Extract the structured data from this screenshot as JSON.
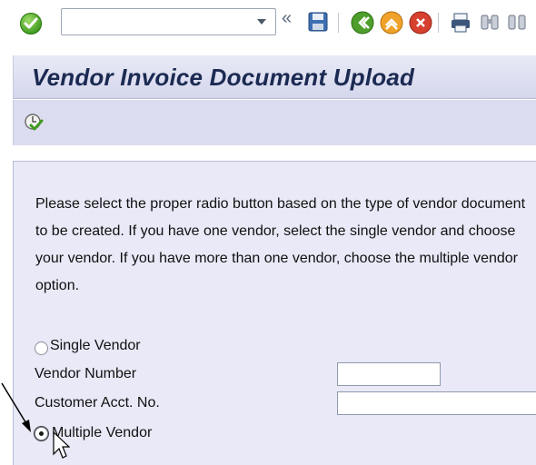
{
  "toolbar": {
    "command_field_value": "",
    "icons": [
      "enter-icon",
      "dropdown-icon",
      "back-chevrons-icon",
      "save-icon",
      "back-icon",
      "exit-icon",
      "cancel-icon",
      "print-icon",
      "find-icon"
    ]
  },
  "page": {
    "title": "Vendor Invoice Document Upload"
  },
  "app_toolbar": {
    "icons": [
      "execute-icon"
    ]
  },
  "form": {
    "instructions": "Please select the proper radio button based on the type of vendor document to be created.  If you have one vendor, select the single vendor and choose your vendor.  If you have more than one vendor, choose the multiple vendor option.",
    "single_vendor_label": "Single Vendor",
    "single_vendor_selected": false,
    "vendor_number_label": "Vendor Number",
    "vendor_number_value": "",
    "customer_acct_label": "Customer Acct. No.",
    "customer_acct_value": "",
    "multiple_vendor_label": "Multiple Vendor",
    "multiple_vendor_selected": true
  },
  "colors": {
    "title_text": "#1b2a52",
    "panel_background": "#e9e9f7",
    "title_background": "#d4d6ec"
  }
}
